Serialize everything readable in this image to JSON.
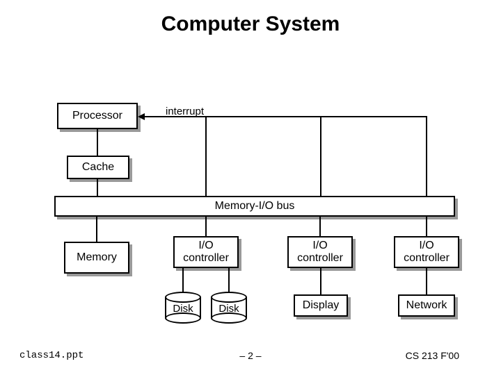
{
  "title": "Computer System",
  "labels": {
    "processor": "Processor",
    "cache": "Cache",
    "interrupt": "interrupt",
    "bus": "Memory-I/O bus",
    "memory": "Memory",
    "io1": "I/O\ncontroller",
    "io2": "I/O\ncontroller",
    "io3": "I/O\ncontroller",
    "disk1": "Disk",
    "disk2": "Disk",
    "display": "Display",
    "network": "Network"
  },
  "footer": {
    "left": "class14.ppt",
    "center": "– 2 –",
    "right": "CS 213 F'00"
  },
  "chart_data": {
    "type": "diagram",
    "title": "Computer System",
    "nodes": [
      {
        "id": "processor",
        "label": "Processor"
      },
      {
        "id": "cache",
        "label": "Cache"
      },
      {
        "id": "bus",
        "label": "Memory-I/O bus"
      },
      {
        "id": "memory",
        "label": "Memory"
      },
      {
        "id": "io1",
        "label": "I/O controller"
      },
      {
        "id": "io2",
        "label": "I/O controller"
      },
      {
        "id": "io3",
        "label": "I/O controller"
      },
      {
        "id": "disk1",
        "label": "Disk",
        "shape": "cylinder"
      },
      {
        "id": "disk2",
        "label": "Disk",
        "shape": "cylinder"
      },
      {
        "id": "display",
        "label": "Display"
      },
      {
        "id": "network",
        "label": "Network"
      }
    ],
    "edges": [
      {
        "from": "processor",
        "to": "cache"
      },
      {
        "from": "cache",
        "to": "bus"
      },
      {
        "from": "memory",
        "to": "bus"
      },
      {
        "from": "io1",
        "to": "bus"
      },
      {
        "from": "io2",
        "to": "bus"
      },
      {
        "from": "io3",
        "to": "bus"
      },
      {
        "from": "io1",
        "to": "processor",
        "label": "interrupt",
        "style": "arrow"
      },
      {
        "from": "io2",
        "to": "processor",
        "label": "interrupt",
        "style": "arrow"
      },
      {
        "from": "io3",
        "to": "processor",
        "label": "interrupt",
        "style": "arrow"
      },
      {
        "from": "disk1",
        "to": "io1"
      },
      {
        "from": "disk2",
        "to": "io1"
      },
      {
        "from": "display",
        "to": "io2"
      },
      {
        "from": "network",
        "to": "io3"
      }
    ]
  }
}
